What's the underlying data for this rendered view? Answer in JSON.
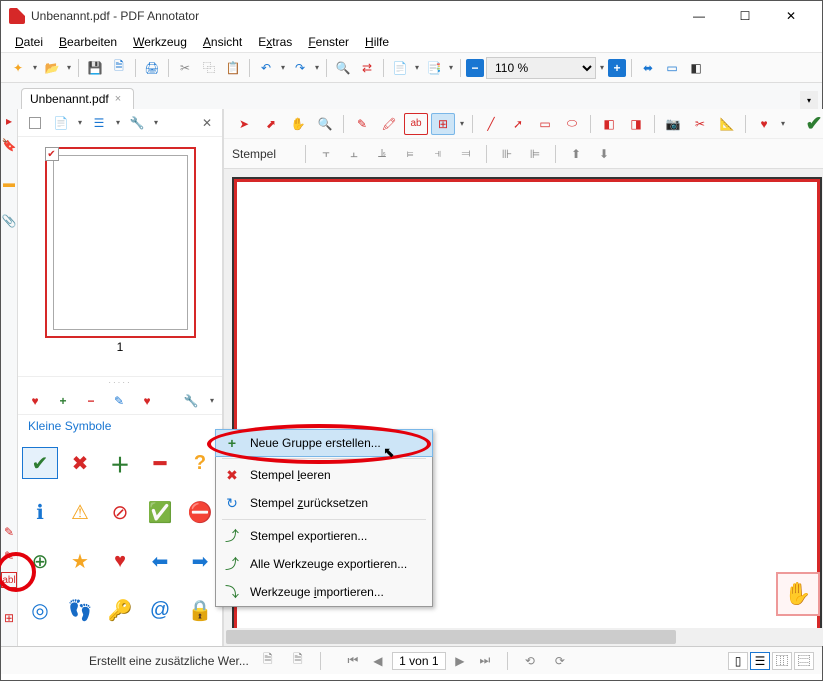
{
  "window": {
    "title": "Unbenannt.pdf - PDF Annotator"
  },
  "menu": {
    "file": "Datei",
    "edit": "Bearbeiten",
    "tool": "Werkzeug",
    "view": "Ansicht",
    "extras": "Extras",
    "window": "Fenster",
    "help": "Hilfe"
  },
  "zoom": {
    "value": "110 %"
  },
  "tab": {
    "name": "Unbenannt.pdf"
  },
  "thumb": {
    "pagenum": "1"
  },
  "fav": {
    "section": "Kleine Symbole"
  },
  "stempel": {
    "label": "Stempel"
  },
  "ctx": {
    "new_group": "Neue Gruppe erstellen...",
    "clear": "Stempel leeren",
    "reset": "Stempel zurücksetzen",
    "export_stamp": "Stempel exportieren...",
    "export_tools": "Alle Werkzeuge exportieren...",
    "import_tools": "Werkzeuge importieren..."
  },
  "status": {
    "text": "Erstellt eine zusätzliche Wer...",
    "page": "1 von 1"
  }
}
